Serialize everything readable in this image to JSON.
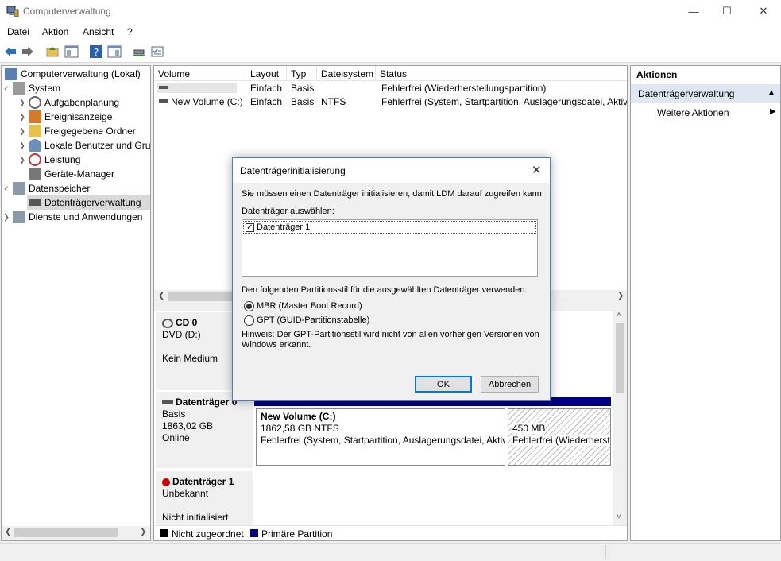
{
  "window": {
    "title": "Computerverwaltung"
  },
  "menu": [
    "Datei",
    "Aktion",
    "Ansicht",
    "?"
  ],
  "tree": {
    "root": "Computerverwaltung (Lokal)",
    "system": "System",
    "tasks": "Aufgabenplanung",
    "events": "Ereignisanzeige",
    "shares": "Freigegebene Ordner",
    "users": "Lokale Benutzer und Gruppen",
    "perf": "Leistung",
    "devmgr": "Geräte-Manager",
    "storage": "Datenspeicher",
    "diskmgmt": "Datenträgerverwaltung",
    "services": "Dienste und Anwendungen"
  },
  "volume_table": {
    "headers": [
      "Volume",
      "Layout",
      "Typ",
      "Dateisystem",
      "Status"
    ],
    "rows": [
      {
        "volume": "",
        "layout": "Einfach",
        "typ": "Basis",
        "fs": "",
        "status": "Fehlerfrei (Wiederherstellungspartition)"
      },
      {
        "volume": "New Volume (C:)",
        "layout": "Einfach",
        "typ": "Basis",
        "fs": "NTFS",
        "status": "Fehlerfrei (System, Startpartition, Auslagerungsdatei, Aktiv, Absturzabbild, Primäre Partition)"
      }
    ]
  },
  "disks": {
    "cd0": {
      "name": "CD 0",
      "type": "DVD (D:)",
      "media": "Kein Medium"
    },
    "disk0": {
      "name": "Datenträger 0",
      "type": "Basis",
      "size": "1863,02 GB",
      "status": "Online",
      "partitions": [
        {
          "name": "New Volume  (C:)",
          "size": "1862,58 GB NTFS",
          "status": "Fehlerfrei (System, Startpartition, Auslagerungsdatei, Aktiv)"
        },
        {
          "size": "450 MB",
          "status": "Fehlerfrei (Wiederherstellungspartition)"
        }
      ]
    },
    "disk1": {
      "name": "Datenträger 1",
      "type": "Unbekannt",
      "status": "Nicht initialisiert"
    }
  },
  "legend": {
    "unallocated": "Nicht zugeordnet",
    "primary": "Primäre Partition"
  },
  "actions": {
    "header": "Aktionen",
    "section": "Datenträgerverwaltung",
    "more": "Weitere Aktionen"
  },
  "dialog": {
    "title": "Datenträgerinitialisierung",
    "intro": "Sie müssen einen Datenträger initialisieren, damit LDM darauf zugreifen kann.",
    "select_label": "Datenträger auswählen:",
    "disk_item": "Datenträger 1",
    "style_label": "Den folgenden Partitionsstil für die ausgewählten Datenträger verwenden:",
    "mbr": "MBR (Master Boot Record)",
    "gpt": "GPT (GUID-Partitionstabelle)",
    "hint_line1": "Hinweis: Der GPT-Partitionsstil wird nicht von allen vorherigen Versionen von",
    "hint_line2": "Windows erkannt.",
    "ok": "OK",
    "cancel": "Abbrechen"
  },
  "colors": {
    "primary_partition": "#000080",
    "selection": "#d9d9d9",
    "actions_section": "#dfe7f2"
  }
}
